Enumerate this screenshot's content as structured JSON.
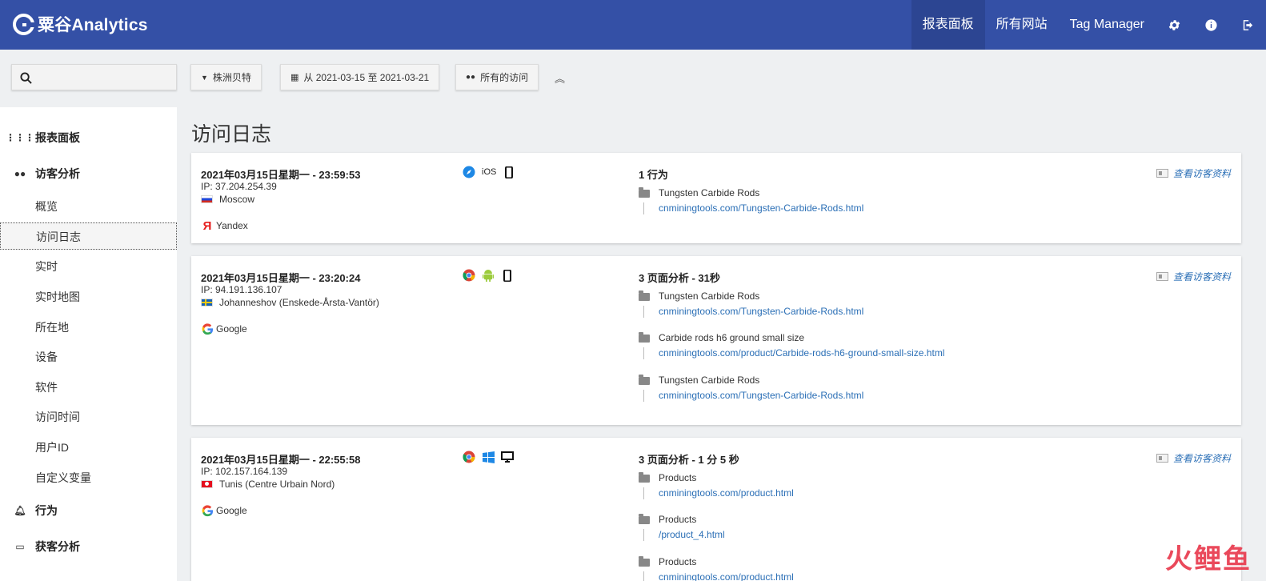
{
  "header": {
    "logo_text": "粟谷Analytics",
    "nav": [
      "报表面板",
      "所有网站",
      "Tag Manager"
    ],
    "icons": [
      "gear-icon",
      "info-icon",
      "logout-icon"
    ],
    "bg_color": "#3450a6"
  },
  "filters": {
    "site": "株洲贝特",
    "date_range": "从 2021-03-15 至 2021-03-21",
    "segment": "所有的访问"
  },
  "sidebar": {
    "sections": [
      {
        "label": "报表面板",
        "icon": "grid-icon"
      },
      {
        "label": "访客分析",
        "icon": "binoculars-icon"
      },
      {
        "label": "行为",
        "icon": "bell-icon"
      },
      {
        "label": "获客分析",
        "icon": "window-icon"
      }
    ],
    "items": [
      "概览",
      "访问日志",
      "实时",
      "实时地图",
      "所在地",
      "设备",
      "软件",
      "访问时间",
      "用户ID",
      "自定义变量"
    ],
    "active_item": "访问日志"
  },
  "page_title": "访问日志",
  "profile_link": "查看访客资料",
  "visits": [
    {
      "time": "2021年03月15日星期一 - 23:59:53",
      "ip": "IP: 37.204.254.39",
      "location": "Moscow",
      "flag": "ru",
      "referrer": "Yandex",
      "device": {
        "browser": "safari-icon",
        "os_label": "iOS",
        "type": "smartphone-icon"
      },
      "summary": "1 行为",
      "actions": [
        {
          "title": "Tungsten Carbide Rods",
          "url": "cnminingtools.com/Tungsten-Carbide-Rods.html"
        }
      ]
    },
    {
      "time": "2021年03月15日星期一 - 23:20:24",
      "ip": "IP: 94.191.136.107",
      "location": "Johanneshov (Enskede-Årsta-Vantör)",
      "flag": "se",
      "referrer": "Google",
      "device": {
        "browser": "chrome-icon",
        "os": "android-icon",
        "type": "smartphone-icon"
      },
      "summary": "3 页面分析 - 31秒",
      "actions": [
        {
          "title": "Tungsten Carbide Rods",
          "url": "cnminingtools.com/Tungsten-Carbide-Rods.html"
        },
        {
          "title": "Carbide rods h6 ground small size",
          "url": "cnminingtools.com/product/Carbide-rods-h6-ground-small-size.html"
        },
        {
          "title": "Tungsten Carbide Rods",
          "url": "cnminingtools.com/Tungsten-Carbide-Rods.html"
        }
      ]
    },
    {
      "time": "2021年03月15日星期一 - 22:55:58",
      "ip": "IP: 102.157.164.139",
      "location": "Tunis (Centre Urbain Nord)",
      "flag": "tn",
      "referrer": "Google",
      "device": {
        "browser": "chrome-icon",
        "os": "windows-icon",
        "type": "desktop-icon"
      },
      "summary": "3 页面分析 - 1 分 5 秒",
      "actions": [
        {
          "title": "Products",
          "url": "cnminingtools.com/product.html"
        },
        {
          "title": "Products",
          "url": "/product_4.html"
        },
        {
          "title": "Products",
          "url": "cnminingtools.com/product.html"
        }
      ]
    }
  ],
  "watermark": "火鲤鱼"
}
